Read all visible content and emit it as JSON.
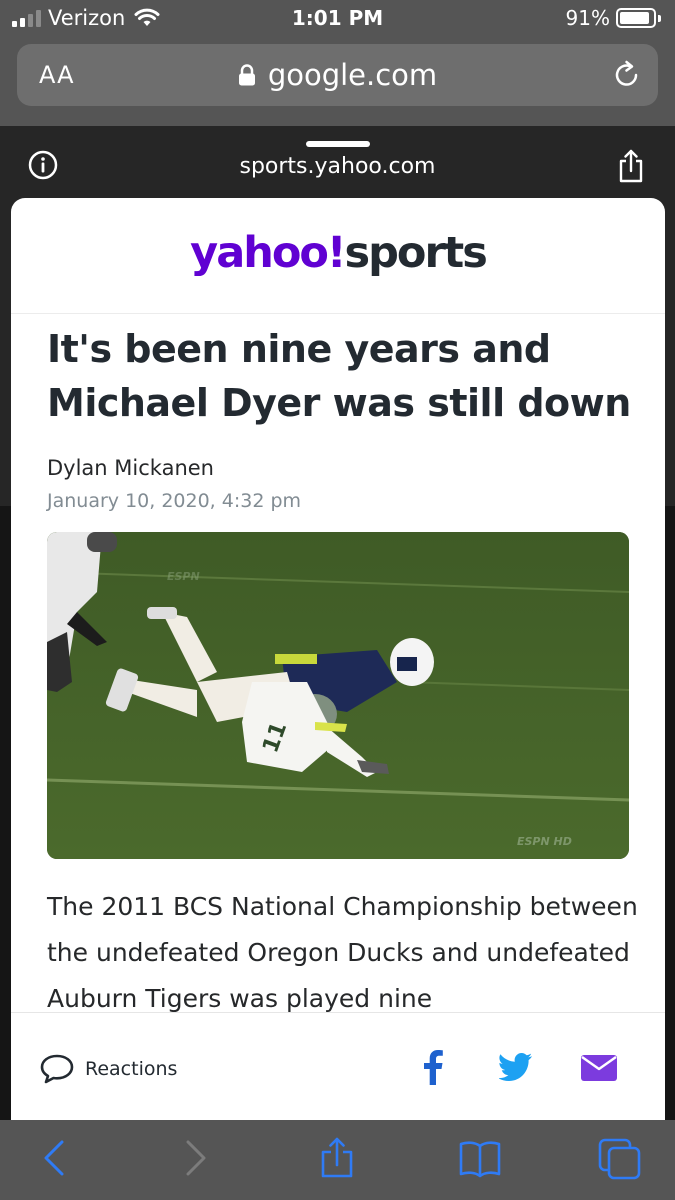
{
  "status_bar": {
    "carrier": "Verizon",
    "time": "1:01 PM",
    "battery_percent": "91%",
    "battery_level": 0.91,
    "signal_bars": 2,
    "signal_total": 4
  },
  "url_bar": {
    "text_size_label": "AA",
    "url": "google.com",
    "lock_icon": "lock-icon",
    "reload_icon": "reload-icon"
  },
  "sheet": {
    "domain": "sports.yahoo.com",
    "info_icon": "info-icon",
    "share_icon": "share-icon"
  },
  "article": {
    "logo_brand": "yahoo!",
    "logo_section": "sports",
    "headline": "It's been nine years and Michael Dyer was still down",
    "author": "Dylan Mickanen",
    "date": "January 10, 2020, 4:32 pm",
    "photo_watermark_top": "ESPN",
    "photo_watermark_bottom": "ESPN HD",
    "body": "The 2011 BCS National Championship between the undefeated Oregon Ducks and undefeated Auburn Tigers was played nine"
  },
  "engagement": {
    "reactions_label": "Reactions",
    "share_icons": [
      "facebook-icon",
      "twitter-icon",
      "mail-icon"
    ]
  },
  "toolbar": {
    "icons": [
      "back-icon",
      "forward-icon",
      "share-icon",
      "bookmarks-icon",
      "tabs-icon"
    ]
  },
  "colors": {
    "yahoo_purple": "#6001d2",
    "ios_blue": "#2f7bf5",
    "chrome_gray": "#555555",
    "headline_text": "#232a31"
  }
}
